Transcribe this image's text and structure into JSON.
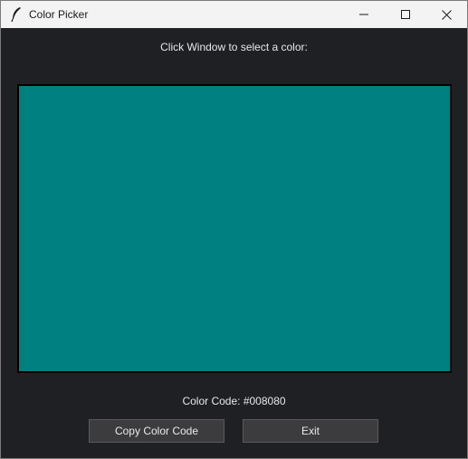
{
  "window": {
    "title": "Color Picker",
    "icon": "feather-icon"
  },
  "controls": {
    "minimize_icon": "minimize-icon",
    "maximize_icon": "maximize-icon",
    "close_icon": "close-icon"
  },
  "main": {
    "instruction": "Click Window to select a color:",
    "selected_color": "#008080",
    "color_code_label": "Color Code: #008080",
    "copy_button_label": "Copy Color Code",
    "exit_button_label": "Exit"
  },
  "colors": {
    "background": "#1f2023",
    "titlebar": "#f3f3f3",
    "button": "#3c3c3e",
    "text": "#e8e8e8"
  }
}
